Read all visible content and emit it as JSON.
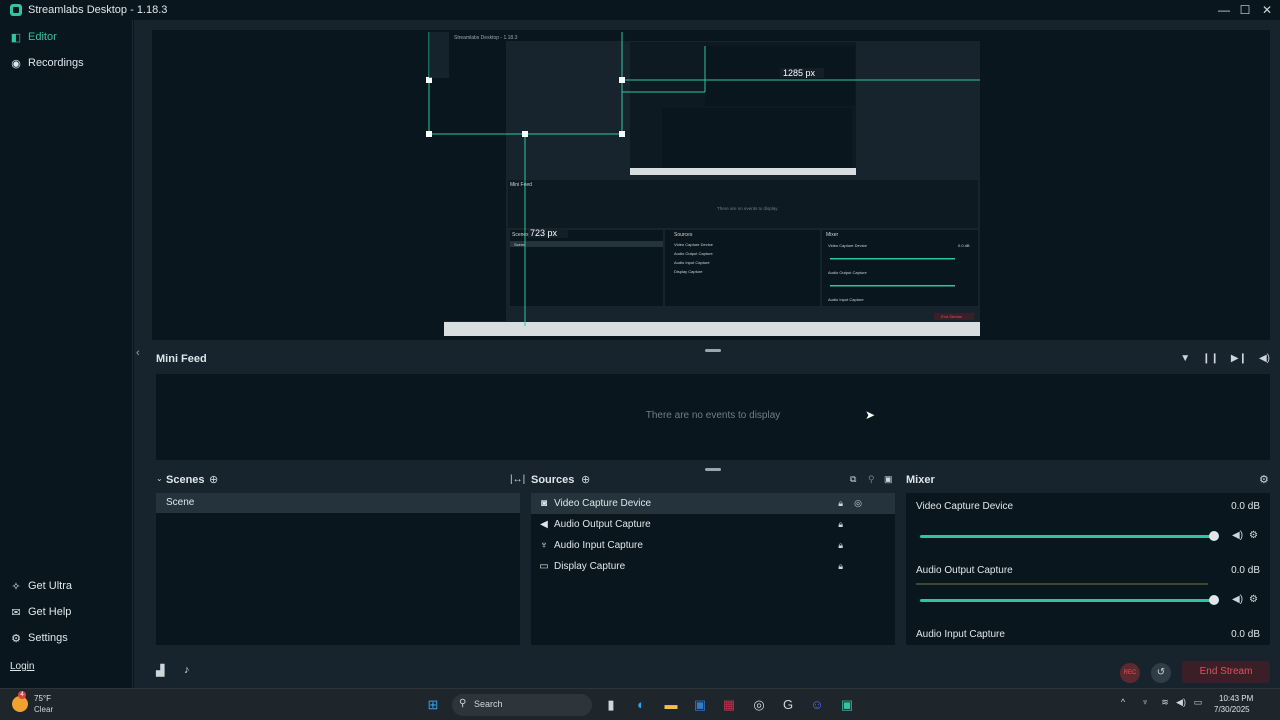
{
  "window": {
    "title": "Streamlabs Desktop - 1.18.3",
    "minimize": "—",
    "maximize": "☐",
    "close": "✕"
  },
  "sidebar": {
    "items": [
      {
        "label": "Editor",
        "icon": "editor-icon",
        "active": true
      },
      {
        "label": "Recordings",
        "icon": "recordings-icon",
        "active": false
      }
    ],
    "bottom_items": [
      {
        "label": "Get Ultra",
        "icon": "ultra-icon"
      },
      {
        "label": "Get Help",
        "icon": "help-icon"
      },
      {
        "label": "Settings",
        "icon": "settings-icon"
      }
    ],
    "login": "Login"
  },
  "preview": {
    "measure_h": "1285 px",
    "measure_v": "723 px",
    "nested_mini_feed": "Mini Feed",
    "nested_empty": "There are no events to display",
    "nested_scenes": "Scenes",
    "nested_scene": "Scene",
    "nested_sources": "Sources",
    "nested_mixer": "Mixer",
    "nested_end_stream": "End Stream",
    "nested_sources_list": [
      "Video Capture Device",
      "Audio Output Capture",
      "Audio Input Capture",
      "Display Capture"
    ],
    "nested_mixer_list": [
      "Video Capture Device",
      "Audio Output Capture",
      "Audio Input Capture"
    ],
    "nested_db": "0.0 dB"
  },
  "mini_feed": {
    "title": "Mini Feed",
    "empty": "There are no events to display"
  },
  "scenes": {
    "title": "Scenes",
    "items": [
      "Scene"
    ]
  },
  "sources": {
    "title": "Sources",
    "items": [
      {
        "label": "Video Capture Device",
        "icon": "camera-icon",
        "selected": true
      },
      {
        "label": "Audio Output Capture",
        "icon": "speaker-icon",
        "selected": false
      },
      {
        "label": "Audio Input Capture",
        "icon": "microphone-icon",
        "selected": false
      },
      {
        "label": "Display Capture",
        "icon": "monitor-icon",
        "selected": false
      }
    ]
  },
  "mixer": {
    "title": "Mixer",
    "items": [
      {
        "label": "Video Capture Device",
        "db": "0.0 dB",
        "level": 1.0
      },
      {
        "label": "Audio Output Capture",
        "db": "0.0 dB",
        "level": 1.0
      },
      {
        "label": "Audio Input Capture",
        "db": "0.0 dB"
      }
    ]
  },
  "footer": {
    "rec": "REC",
    "end_stream": "End Stream"
  },
  "taskbar": {
    "weather_temp": "75°F",
    "weather_cond": "Clear",
    "weather_badge": "4",
    "search_placeholder": "Search",
    "time": "10:43 PM",
    "date": "7/30/2025"
  },
  "colors": {
    "accent": "#31c3a2",
    "bg_dark": "#09161d",
    "bg_panel": "#17242d",
    "danger": "#e05263"
  }
}
